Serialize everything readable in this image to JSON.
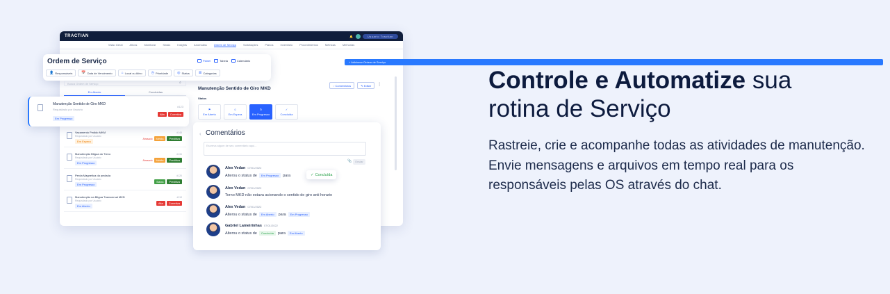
{
  "headline": {
    "bold": "Controle e Automatize",
    "rest_line1": " sua",
    "line2": "rotina de Serviço"
  },
  "paragraph": "Rastreie, crie e acompanhe todas as atividades de manutenção. Envie mensagens e arquivos em tempo real para os responsáveis pelas OS através do chat.",
  "app": {
    "brand": "TRACTIAN",
    "user": "Usuario Tractian",
    "nav": [
      "Visão Geral",
      "Ativos",
      "Monitorar",
      "Sinais",
      "Insights",
      "Anomalias",
      "Ordem de Serviço",
      "Solicitações",
      "Planos",
      "Inventário",
      "Procedimentos",
      "Métricas",
      "Melhorias"
    ],
    "nav_active": "Ordem de Serviço",
    "add_button": "+ Adicionar Ordem de Serviço",
    "ordem_title": "Ordem de Serviço",
    "views": {
      "painel": "Painel",
      "tabela": "Tabela",
      "calendario": "Calendário"
    },
    "filters": [
      "Responsáveis",
      "Data de Vencimento",
      "Local ou Ativo",
      "Prioridade",
      "Status",
      "Categorias"
    ],
    "search_placeholder": "Busca Ordem de Serviço",
    "tabs": {
      "open": "Em Aberto",
      "done": "Concluídas"
    },
    "selected": {
      "title": "Manutenção Sentido de Giro MKD",
      "subtitle": "Requisitado por Usuário",
      "num": "#123",
      "tag1": "Alta",
      "tag2": "Corretiva",
      "status": "Em Progresso"
    },
    "rows": [
      {
        "title": "Vazamento Pedido MKM",
        "sub": "Requisitado por Usuário",
        "num": "#145",
        "status": "Em Espera",
        "late": "Atrasado",
        "t1": "Média",
        "t2": "Preditiva"
      },
      {
        "title": "Manutenção Bitgua do Trevo",
        "sub": "Requisitado por Usuário",
        "num": "#134",
        "status": "Em Progresso",
        "late": "Atrasado",
        "t1": "Média",
        "t2": "Preditiva"
      },
      {
        "title": "Perda Magnetica da peclada",
        "sub": "Requisitado por Usuário",
        "num": "#120",
        "status": "Em Progresso",
        "late": "",
        "t1": "Baixa",
        "t2": "Preditiva"
      },
      {
        "title": "Manutenção na Bitgua Transversal MKD",
        "sub": "Requisitado por Usuário",
        "num": "#113",
        "status": "Em Aberto",
        "late": "",
        "t1": "Alta",
        "t2": "Corretiva"
      }
    ],
    "detail": {
      "title": "Manutenção Sentido de Giro MKD",
      "comentarios_btn": "Comentários",
      "editar_btn": "Editar",
      "status_label": "Status",
      "status_options": [
        "Em Aberto",
        "Em Espera",
        "Em Progresso",
        "Concluída"
      ],
      "status_active": "Em Progresso"
    },
    "comments": {
      "title": "Comentários",
      "placeholder": "Escreva algum de seu comentário aqui...",
      "send": "Enviar",
      "items": [
        {
          "name": "Alex Vedan",
          "date": "07/01/2022",
          "pre": "Alterou o status de",
          "from": "Em Progresso",
          "mid": "para",
          "to": "",
          "text": ""
        },
        {
          "name": "Alex Vedan",
          "date": "07/01/2022",
          "pre": "",
          "from": "",
          "mid": "",
          "to": "",
          "text": "Torno MKD não estava acionando o sentido de giro anti horario"
        },
        {
          "name": "Alex Vedan",
          "date": "07/01/2022",
          "pre": "Alterou o status de",
          "from": "Em Aberto",
          "mid": "para",
          "to": "Em Progresso",
          "text": ""
        },
        {
          "name": "Gabriel Lameirinhas",
          "date": "07/01/2022",
          "pre": "Alterou o status de",
          "from": "Concluída",
          "mid": "para",
          "to": "Em Aberto",
          "text": ""
        }
      ],
      "floating_chip": "Concluída"
    }
  }
}
